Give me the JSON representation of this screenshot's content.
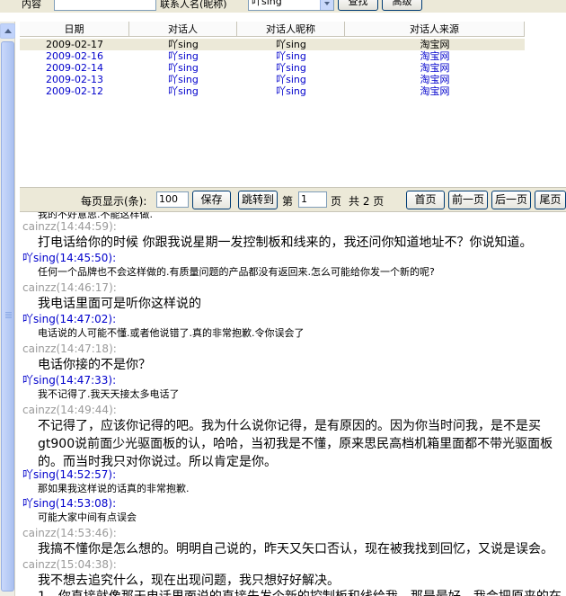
{
  "search_bar": {
    "content_label": "内容",
    "contact_label": "联系人名(昵称)",
    "contact_value": "吖sing",
    "search_button": "查找",
    "advanced_button": "高级"
  },
  "grid": {
    "columns": [
      "日期",
      "对话人",
      "对话人昵称",
      "对话人来源"
    ],
    "rows": [
      {
        "date": "2009-02-17",
        "person": "吖sing",
        "nickname": "吖sing",
        "source": "淘宝网"
      },
      {
        "date": "2009-02-16",
        "person": "吖sing",
        "nickname": "吖sing",
        "source": "淘宝网"
      },
      {
        "date": "2009-02-14",
        "person": "吖sing",
        "nickname": "吖sing",
        "source": "淘宝网"
      },
      {
        "date": "2009-02-13",
        "person": "吖sing",
        "nickname": "吖sing",
        "source": "淘宝网"
      },
      {
        "date": "2009-02-12",
        "person": "吖sing",
        "nickname": "吖sing",
        "source": "淘宝网"
      }
    ]
  },
  "pager": {
    "per_page_label": "每页显示(条):",
    "per_page_value": "100",
    "save_button": "保存",
    "jump_button": "跳转到",
    "page_prefix": "第",
    "page_value": "1",
    "page_suffix": "页",
    "total_label": "共 2 页",
    "first_button": "首页",
    "prev_button": "前一页",
    "next_button": "后一页",
    "last_button": "尾页"
  },
  "chat": {
    "partial_line": "我的不好意思.不能这样做.",
    "messages": [
      {
        "sender": "cainzz(14:44:59):",
        "text": "打电话给你的时候 你跟我说星期一发控制板和线来的，我还问你知道地址不？你说知道。"
      },
      {
        "sender": "吖sing(14:45:50):",
        "text": "任何一个品牌也不会这样做的.有质量问题的产品都没有返回来.怎么可能给你发一个新的呢?"
      },
      {
        "sender": "cainzz(14:46:17):",
        "text": "我电话里面可是听你这样说的"
      },
      {
        "sender": "吖sing(14:47:02):",
        "text": "电话说的人可能不懂.或者他说错了.真的非常抱歉.令你误会了"
      },
      {
        "sender": "cainzz(14:47:18):",
        "text": "电话你接的不是你？"
      },
      {
        "sender": "吖sing(14:47:33):",
        "text": "我不记得了.我天天接太多电话了"
      },
      {
        "sender": "cainzz(14:49:44):",
        "text": "不记得了，应该你记得的吧。我为什么说你记得，是有原因的。因为你当时问我，是不是买gt900说前面少光驱面板的认，哈哈，当初我是不懂，原来思民高档机箱里面都不带光驱面板的。而当时我只对你说过。所以肯定是你。"
      },
      {
        "sender": "吖sing(14:52:57):",
        "text": "那如果我这样说的话真的非常抱歉."
      },
      {
        "sender": "吖sing(14:53:08):",
        "text": "可能大家中间有点误会"
      },
      {
        "sender": "cainzz(14:53:46):",
        "text": "我搞不懂你是怎么想的。明明自己说的，昨天又矢口否认，现在被我找到回忆，又说是误会。"
      },
      {
        "sender": "cainzz(15:04:38):",
        "text": "我不想去追究什么，现在出现问题，我只想好好解决。"
      }
    ],
    "bottom_partial": "1、你直接就像那天电话里面说的直接先发个新的控制板和线给我，那是最好，我会把原来的在"
  }
}
